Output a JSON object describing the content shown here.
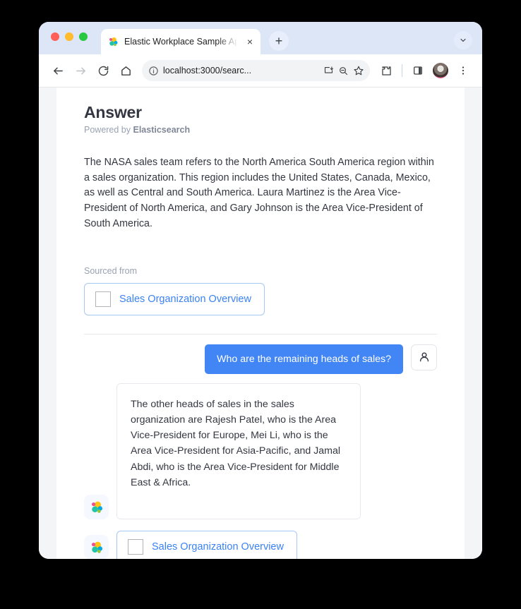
{
  "browser": {
    "tab": {
      "title": "Elastic Workplace Sample App",
      "favicon": "elastic-logo-icon",
      "close_label": "×"
    },
    "new_tab_label": "+",
    "tabstrip_chevron": "chevron-down-icon",
    "toolbar": {
      "back": "back-arrow-icon",
      "forward": "forward-arrow-icon",
      "reload": "reload-icon",
      "home": "home-icon",
      "site_info": "info-circle-icon",
      "url": "localhost:3000/searc...",
      "install": "install-app-icon",
      "zoom": "zoom-out-icon",
      "bookmark": "star-icon",
      "extensions": "extensions-puzzle-icon",
      "side_panel": "side-panel-icon",
      "profile": "profile-avatar",
      "menu": "three-dot-menu-icon"
    },
    "traffic_lights": {
      "close": "#ff5f57",
      "minimize": "#febc2e",
      "maximize": "#28c840"
    }
  },
  "page": {
    "answer": {
      "title": "Answer",
      "powered_by_prefix": "Powered by ",
      "powered_by_brand": "Elasticsearch",
      "body": "The NASA sales team refers to the North America South America region within a sales organization. This region includes the United States, Canada, Mexico, as well as Central and South America. Laura Martinez is the Area Vice-President of North America, and Gary Johnson is the Area Vice-President of South America.",
      "sourced_from_label": "Sourced from",
      "source_document": "Sales Organization Overview"
    },
    "conversation": {
      "user_message": "Who are the remaining heads of sales?",
      "user_icon": "user-avatar-icon",
      "assistant_icon": "elastic-logo-icon",
      "assistant_message": "The other heads of sales in the sales organization are Rajesh Patel, who is the Area Vice-President for Europe, Mei Li, who is the Area Vice-President for Asia-Pacific, and Jamal Abdi, who is the Area Vice-President for Middle East & Africa.",
      "assistant_source_document": "Sales Organization Overview"
    }
  },
  "colors": {
    "accent_blue": "#4285f4",
    "link_blue": "#3b82f6",
    "text_dark": "#343741",
    "muted_gray": "#98a2b3"
  }
}
